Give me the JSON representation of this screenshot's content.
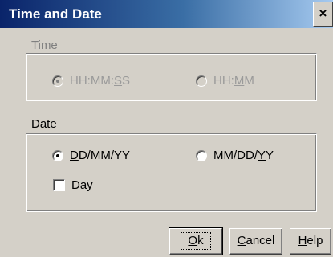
{
  "window": {
    "title": "Time and Date",
    "close_glyph": "×",
    "close_icon": "close-icon"
  },
  "time_group": {
    "label": "Time",
    "options": [
      {
        "label_pre": "HH:MM:",
        "label_u": "S",
        "label_post": "S",
        "selected": true,
        "disabled": true
      },
      {
        "label_pre": "HH:",
        "label_u": "M",
        "label_post": "M",
        "selected": false,
        "disabled": true
      }
    ]
  },
  "date_group": {
    "label": "Date",
    "options": [
      {
        "label_pre": "",
        "label_u": "D",
        "label_post": "D/MM/YY",
        "selected": true
      },
      {
        "label_pre": "MM/DD/",
        "label_u": "Y",
        "label_post": "Y",
        "selected": false
      }
    ],
    "day_checkbox": {
      "label": "Day",
      "checked": false
    }
  },
  "buttons": {
    "ok": {
      "u": "O",
      "rest": "k"
    },
    "cancel": {
      "u": "C",
      "rest": "ancel"
    },
    "help": {
      "u": "H",
      "rest": "elp"
    }
  },
  "colors": {
    "face": "#d4d0c8",
    "title_start": "#0a246a",
    "title_end": "#a6caf0",
    "disabled_text": "#9a9a9a"
  }
}
